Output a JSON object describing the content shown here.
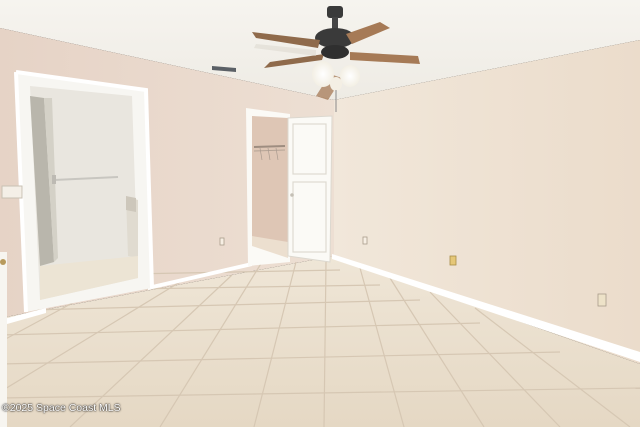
{
  "photo": {
    "watermark": "©2025 Space Coast MLS",
    "colors": {
      "ceiling": "#f4f2ec",
      "left_wall": "#ead9cd",
      "right_wall": "#eee3d5",
      "floor": "#ece1d0",
      "grout": "#d2c3ae",
      "baseboard": "#ffffff",
      "door": "#fbfaf6",
      "closet_interior": "#dcc5b4",
      "bathroom_wall": "#eae7e0",
      "fan_blade": "#a67a56",
      "fan_body": "#3a3a3a"
    }
  }
}
